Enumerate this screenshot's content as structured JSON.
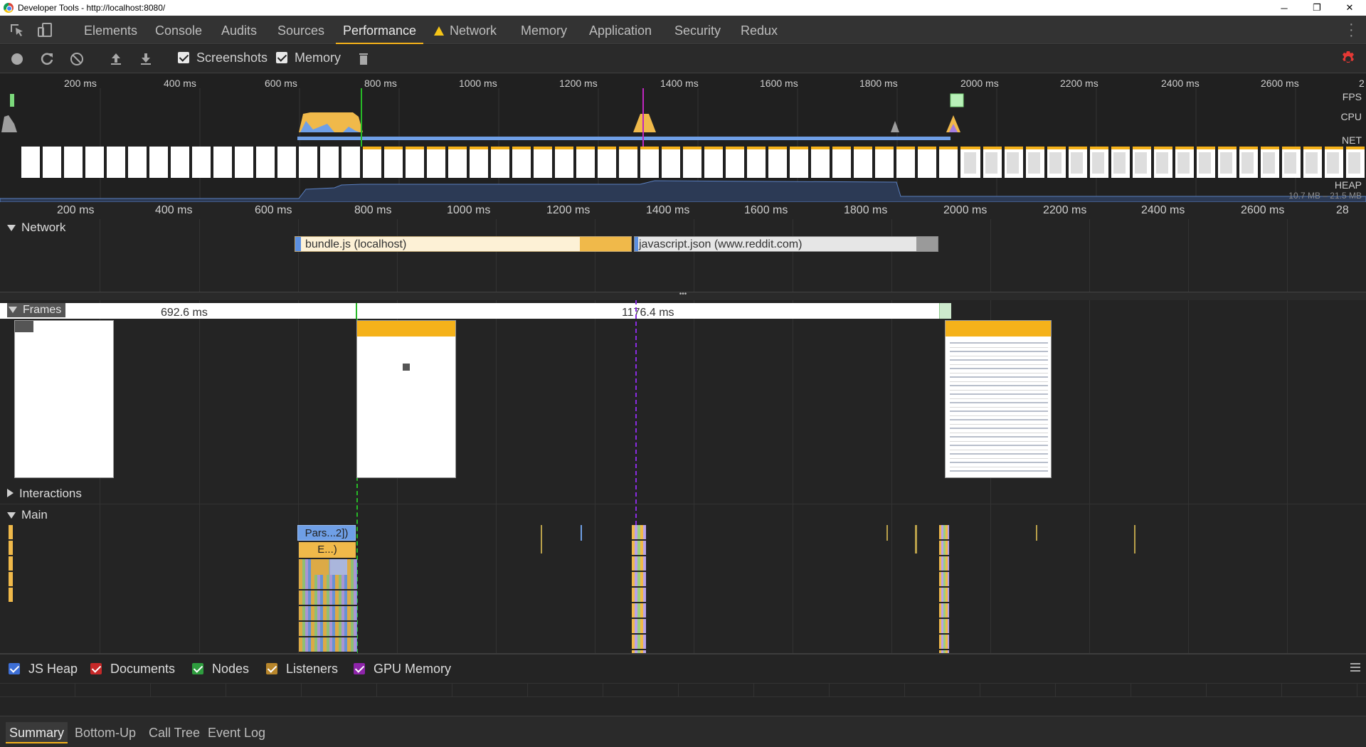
{
  "window": {
    "title": "Developer Tools - http://localhost:8080/",
    "controls": [
      "─",
      "❐",
      "✕"
    ]
  },
  "tabs": [
    {
      "label": "Elements"
    },
    {
      "label": "Console"
    },
    {
      "label": "Audits"
    },
    {
      "label": "Sources"
    },
    {
      "label": "Performance",
      "active": true
    },
    {
      "label": "Network",
      "warning": true
    },
    {
      "label": "Memory"
    },
    {
      "label": "Application"
    },
    {
      "label": "Security"
    },
    {
      "label": "Redux"
    }
  ],
  "toolbar": {
    "screenshots_label": "Screenshots",
    "screenshots_checked": true,
    "memory_label": "Memory",
    "memory_checked": true,
    "icons": [
      "record-icon",
      "reload-icon",
      "clear-icon",
      "upload-icon",
      "download-icon",
      "trash-icon",
      "gear-icon"
    ],
    "gear_color": "#e53935"
  },
  "overview": {
    "ruler_labels": [
      "200 ms",
      "400 ms",
      "600 ms",
      "800 ms",
      "1000 ms",
      "1200 ms",
      "1400 ms",
      "1600 ms",
      "1800 ms",
      "2000 ms",
      "2200 ms",
      "2400 ms",
      "2600 ms",
      "2"
    ],
    "fps_label": "FPS",
    "cpu_label": "CPU",
    "net_label": "NET",
    "heap_label": "HEAP",
    "heap_range": "10.7 MB – 21.5 MB"
  },
  "ruler2_labels": [
    "200 ms",
    "400 ms",
    "600 ms",
    "800 ms",
    "1000 ms",
    "1200 ms",
    "1400 ms",
    "1600 ms",
    "1800 ms",
    "2000 ms",
    "2200 ms",
    "2400 ms",
    "2600 ms",
    "28"
  ],
  "network": {
    "label": "Network",
    "requests": [
      {
        "name": "bundle.js (localhost)"
      },
      {
        "name": "javascript.json (www.reddit.com)"
      }
    ]
  },
  "frames": {
    "label": "Frames",
    "durations": [
      "692.6 ms",
      "1176.4 ms"
    ]
  },
  "interactions_label": "Interactions",
  "main": {
    "label": "Main",
    "entries": [
      "Pars...2])",
      "E...)"
    ]
  },
  "counters": [
    {
      "label": "JS Heap",
      "color": "#3d6fd6"
    },
    {
      "label": "Documents",
      "color": "#c62828"
    },
    {
      "label": "Nodes",
      "color": "#2e9d3e"
    },
    {
      "label": "Listeners",
      "color": "#b8862b"
    },
    {
      "label": "GPU Memory",
      "color": "#8e24aa"
    }
  ],
  "bottom_tabs": [
    {
      "label": "Summary",
      "active": true
    },
    {
      "label": "Bottom-Up"
    },
    {
      "label": "Call Tree"
    },
    {
      "label": "Event Log"
    }
  ]
}
